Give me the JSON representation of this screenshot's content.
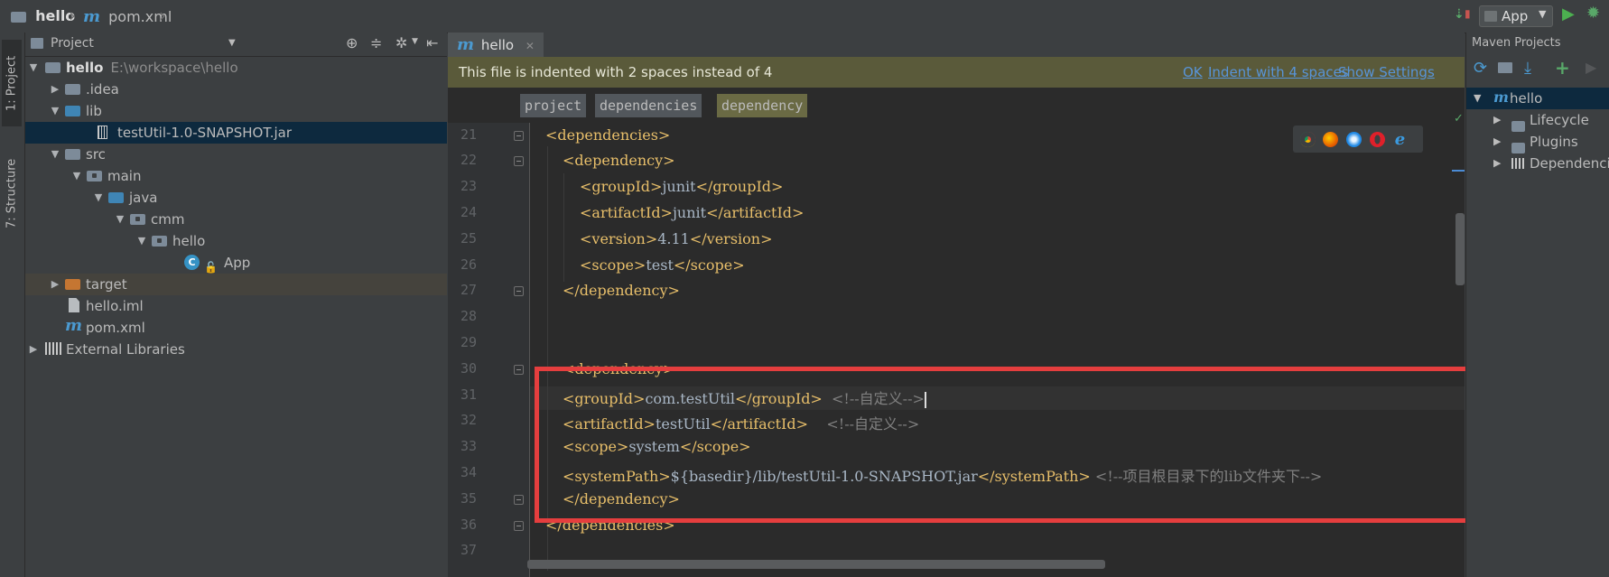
{
  "navbar": {
    "project_name": "hello",
    "file_name": "pom.xml",
    "run_config": "App"
  },
  "left_strip": {
    "project_tab": "1: Project",
    "structure_tab": "7: Structure"
  },
  "project_panel": {
    "title": "Project",
    "tree": [
      {
        "label": "hello",
        "extra": "E:\\workspace\\hello"
      },
      {
        "label": ".idea"
      },
      {
        "label": "lib"
      },
      {
        "label": "testUtil-1.0-SNAPSHOT.jar"
      },
      {
        "label": "src"
      },
      {
        "label": "main"
      },
      {
        "label": "java"
      },
      {
        "label": "cmm"
      },
      {
        "label": "hello"
      },
      {
        "label": "App"
      },
      {
        "label": "target"
      },
      {
        "label": "hello.iml"
      },
      {
        "label": "pom.xml"
      },
      {
        "label": "External Libraries"
      }
    ]
  },
  "editor": {
    "tab_label": "hello",
    "notice": {
      "message": "This file is indented with 2 spaces instead of 4",
      "ok": "OK",
      "indent": "Indent with 4 spaces",
      "settings": "Show Settings"
    },
    "breadcrumbs": [
      "project",
      "dependencies",
      "dependency"
    ],
    "line_numbers": [
      "21",
      "22",
      "23",
      "24",
      "25",
      "26",
      "27",
      "28",
      "29",
      "30",
      "31",
      "32",
      "33",
      "34",
      "35",
      "36",
      "37"
    ],
    "lines": {
      "l21": "<dependencies>",
      "l22": "<dependency>",
      "l23_open": "<groupId>",
      "l23_val": "junit",
      "l23_close": "</groupId>",
      "l24_open": "<artifactId>",
      "l24_val": "junit",
      "l24_close": "</artifactId>",
      "l25_open": "<version>",
      "l25_val": "4.11",
      "l25_close": "</version>",
      "l26_open": "<scope>",
      "l26_val": "test",
      "l26_close": "</scope>",
      "l27": "</dependency>",
      "l30": "<dependency>",
      "l31_open": "<groupId>",
      "l31_val": "com.testUtil",
      "l31_close": "</groupId>",
      "l31_cm": "<!--自定义-->",
      "l32_open": "<artifactId>",
      "l32_val": "testUtil",
      "l32_close": "</artifactId>",
      "l32_cm": "<!--自定义-->",
      "l33_open": "<scope>",
      "l33_val": "system",
      "l33_close": "</scope>",
      "l34_open": "<systemPath>",
      "l34_val": "${basedir}/lib/testUtil-1.0-SNAPSHOT.jar",
      "l34_close": "</systemPath>",
      "l34_cm": "<!--项目根目录下的lib文件夹下-->",
      "l35": "</dependency>",
      "l36": "</dependencies>"
    }
  },
  "maven": {
    "title": "Maven Projects",
    "root": "hello",
    "items": [
      "Lifecycle",
      "Plugins",
      "Dependencies"
    ]
  },
  "colors": {
    "highlight_box": "#e53e3e",
    "tag": "#e8bf6a",
    "comment": "#808080",
    "text": "#a9b7c6"
  }
}
